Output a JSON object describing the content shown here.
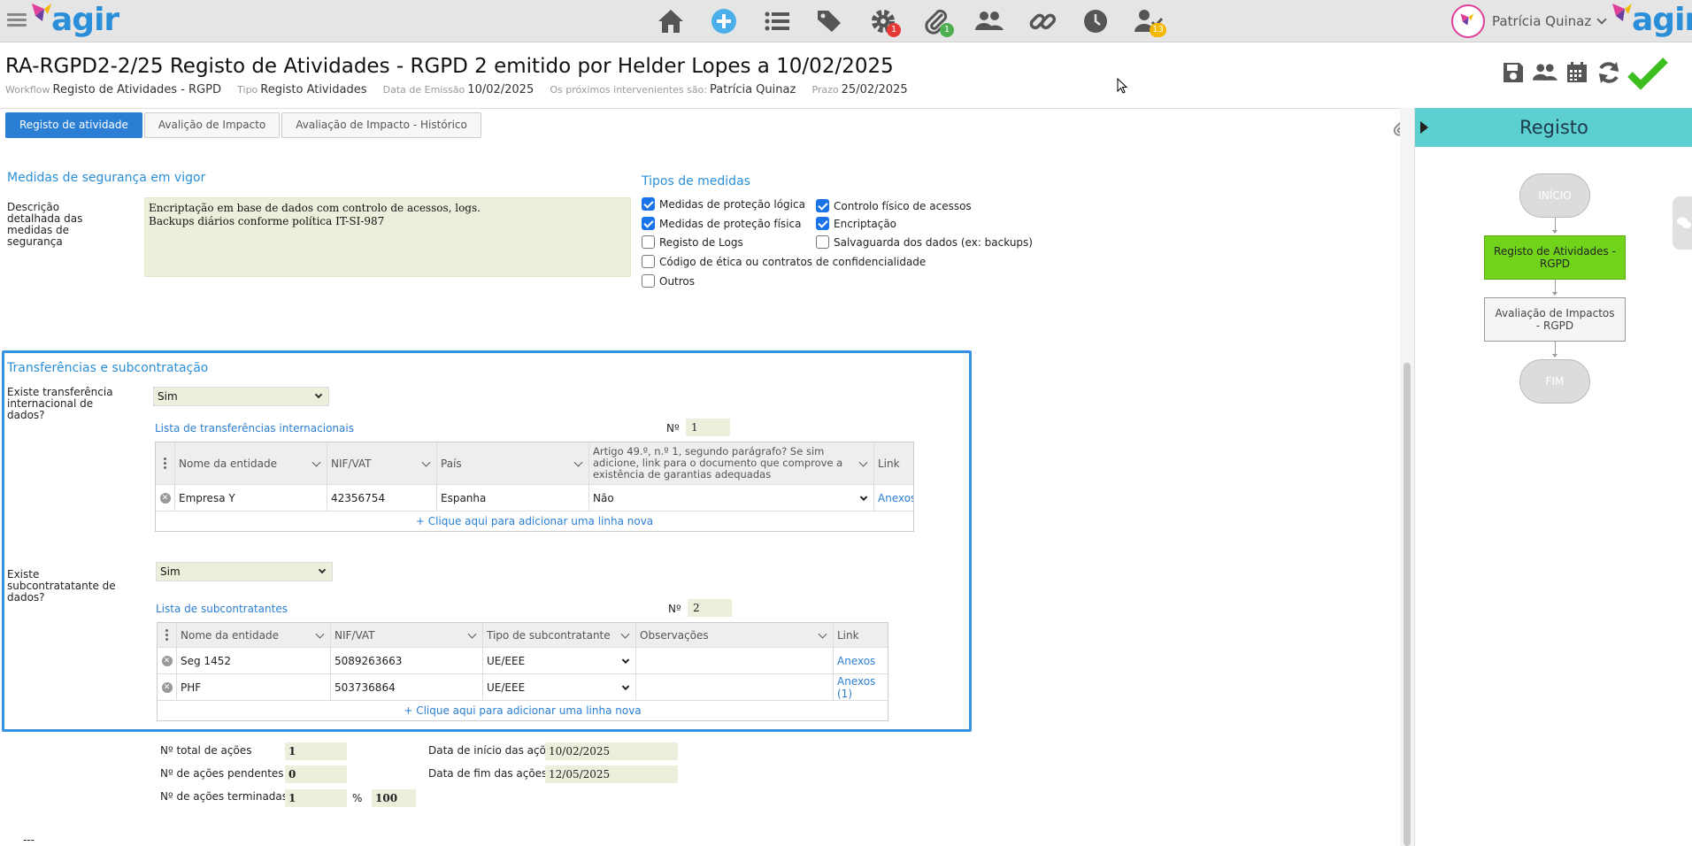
{
  "app": {
    "logo_text": "agir"
  },
  "topbar": {
    "nav": [
      {
        "name": "home-icon",
        "badge": ""
      },
      {
        "name": "add-icon",
        "badge": ""
      },
      {
        "name": "list-icon",
        "badge": ""
      },
      {
        "name": "tags-icon",
        "badge": ""
      },
      {
        "name": "gear-icon",
        "badge": "1",
        "badge_color": "#e53935"
      },
      {
        "name": "paperclip-icon",
        "badge": "1",
        "badge_color": "#4caf50"
      },
      {
        "name": "users-icon",
        "badge": ""
      },
      {
        "name": "link-icon",
        "badge": ""
      },
      {
        "name": "clock-icon",
        "badge": ""
      },
      {
        "name": "user-check-icon",
        "badge": "13",
        "badge_color": "#f5b800"
      }
    ],
    "user_name": "Patrícia Quinaz"
  },
  "header": {
    "title": "RA-RGPD2-2/25 Registo de Atividades - RGPD 2 emitido por Helder Lopes a 10/02/2025",
    "meta": [
      {
        "label": "Workflow",
        "value": "Registo de Atividades - RGPD"
      },
      {
        "label": "Tipo",
        "value": "Registo Atividades"
      },
      {
        "label": "Data de Emissão",
        "value": "10/02/2025"
      },
      {
        "label": "Os próximos intervenientes são:",
        "value": "Patrícia Quinaz"
      },
      {
        "label": "Prazo",
        "value": "25/02/2025"
      }
    ]
  },
  "tabs": [
    "Registo de atividade",
    "Avalição de Impacto",
    "Avaliação de Impacto - Histórico"
  ],
  "security": {
    "title": "Medidas de segurança em vigor",
    "desc_label": "Descrição detalhada das medidas de segurança",
    "desc_line1": "Encriptação em base de dados com controlo de acessos, logs.",
    "desc_line2": "Backups diários conforme política IT-SI-987",
    "types_title": "Tipos de medidas",
    "checks": [
      {
        "label": "Medidas de proteção lógica",
        "checked": true
      },
      {
        "label": "Controlo físico de acessos",
        "checked": true
      },
      {
        "label": "Medidas de proteção física",
        "checked": true
      },
      {
        "label": "Encriptação",
        "checked": true
      },
      {
        "label": "Registo de Logs",
        "checked": false
      },
      {
        "label": "Salvaguarda dos dados (ex: backups)",
        "checked": false
      },
      {
        "label": "Código de ética ou contratos de confidencialidade",
        "checked": false
      },
      {
        "label": "Outros",
        "checked": false
      }
    ]
  },
  "transfers": {
    "title": "Transferências e subcontratação",
    "intl_label": "Existe transferência internacional de dados?",
    "intl_value": "Sim",
    "intl_list_title": "Lista de transferências internacionais",
    "intl_count_label": "Nº",
    "intl_count": "1",
    "intl_headers": [
      "Nome da entidade",
      "NIF/VAT",
      "País",
      "Artigo 49.º, n.º 1, segundo parágrafo? Se sim adicione, link para o documento que comprove a existência de garantias adequadas",
      "Link"
    ],
    "intl_rows": [
      {
        "name": "Empresa Y",
        "nif": "42356754",
        "country": "Espanha",
        "art49": "Não",
        "link": "Anexos"
      }
    ],
    "add_row": "+ Clique aqui para adicionar uma linha nova",
    "sub_label": "Existe subcontratatante de dados?",
    "sub_value": "Sim",
    "sub_list_title": "Lista de subcontratantes",
    "sub_count_label": "Nº",
    "sub_count": "2",
    "sub_headers": [
      "Nome da entidade",
      "NIF/VAT",
      "Tipo de subcontratante",
      "Observações",
      "Link"
    ],
    "sub_rows": [
      {
        "name": "Seg 1452",
        "nif": "5089263663",
        "type": "UE/EEE",
        "obs": "",
        "link": "Anexos"
      },
      {
        "name": "PHF",
        "nif": "503736864",
        "type": "UE/EEE",
        "obs": "",
        "link": "Anexos (1)"
      }
    ]
  },
  "summary": {
    "total_label": "Nº total de ações",
    "total": "1",
    "pending_label": "Nº de ações pendentes",
    "pending": "0",
    "done_label": "Nº de ações terminadas",
    "done": "1",
    "pct_label": "%",
    "pct": "100",
    "start_label": "Data de início das ações",
    "start": "10/02/2025",
    "end_label": "Data de fim das ações",
    "end": "12/05/2025"
  },
  "footer_text": "---",
  "workflow": {
    "title": "Registo",
    "steps": [
      "INÍCIO",
      "Registo de Atividades - RGPD",
      "Avaliação de Impactos - RGPD",
      "FIM"
    ]
  }
}
